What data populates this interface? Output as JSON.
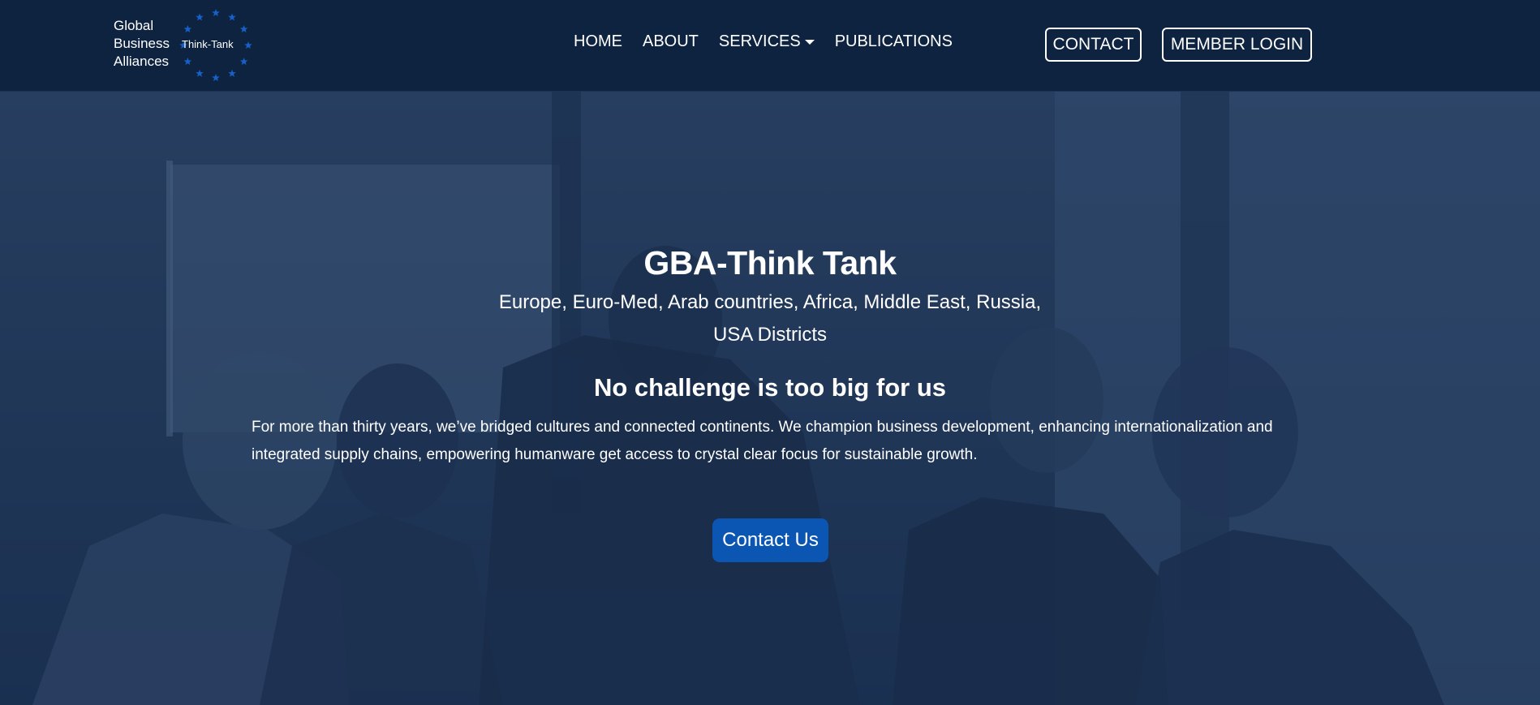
{
  "logo": {
    "lines": [
      "Global",
      "Business",
      "Alliances"
    ],
    "tag": "Think-Tank",
    "star_color": "#1660c8"
  },
  "nav": {
    "items": [
      {
        "label": "HOME"
      },
      {
        "label": "ABOUT"
      },
      {
        "label": "SERVICES",
        "has_dropdown": true
      },
      {
        "label": "PUBLICATIONS"
      }
    ],
    "contact_label": "CONTACT",
    "login_label": "MEMBER LOGIN"
  },
  "hero": {
    "title": "GBA-Think Tank",
    "subtitle": "Europe, Euro-Med, Arab countries, Africa, Middle East, Russia, USA Districts",
    "heading": "No challenge is too big for us",
    "body": "For more than thirty years, we’ve bridged cultures and connected continents. We champion business development, enhancing internationalization and integrated supply chains, empowering humanware get access to crystal clear focus for sustainable growth.",
    "cta_label": "Contact Us"
  },
  "colors": {
    "navbar_bg": "#0e2340",
    "overlay": "#1e3457",
    "cta_bg": "#0b56b3",
    "text": "#ffffff"
  }
}
